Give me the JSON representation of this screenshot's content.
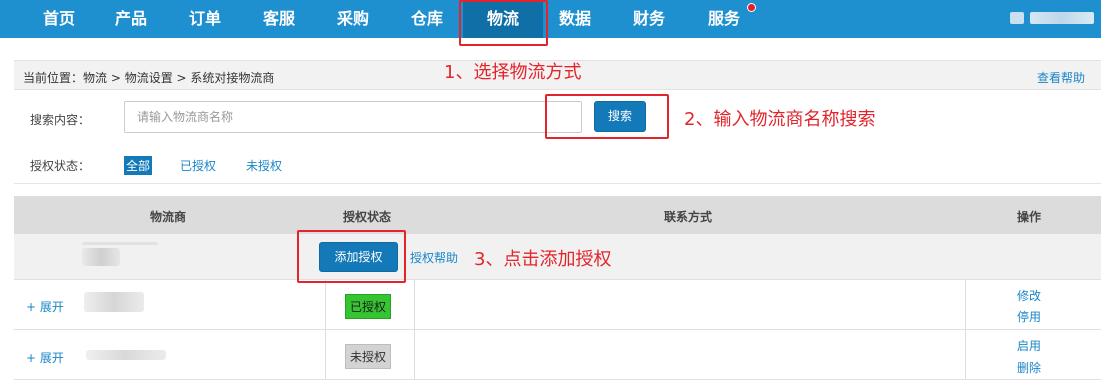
{
  "nav": {
    "items": [
      "首页",
      "产品",
      "订单",
      "客服",
      "采购",
      "仓库",
      "物流",
      "数据",
      "财务",
      "服务"
    ],
    "active": "物流",
    "colors": {
      "bar": "#1e8fcf",
      "active": "#0f6fa6",
      "dot": "#e01e2c"
    }
  },
  "breadcrumb": {
    "label": "当前位置：",
    "path": "物流 > 物流设置 > 系统对接物流商",
    "help": "查看帮助"
  },
  "search": {
    "label": "搜索内容：",
    "placeholder": "请输入物流商名称",
    "button": "搜索"
  },
  "auth_filter": {
    "label": "授权状态：",
    "options": [
      "全部",
      "已授权",
      "未授权"
    ],
    "active": "全部"
  },
  "table": {
    "headers": [
      "物流商",
      "授权状态",
      "联系方式",
      "操作"
    ],
    "add_row": {
      "add_button": "添加授权",
      "help_link": "授权帮助"
    },
    "rows": [
      {
        "expand": "+ 展开",
        "status": "已授权",
        "status_color": "#35c531",
        "actions": [
          "修改",
          "停用"
        ]
      },
      {
        "expand": "+ 展开",
        "status": "未授权",
        "status_color": "#d3d3d3",
        "actions": [
          "启用",
          "删除"
        ]
      }
    ]
  },
  "annotations": {
    "step1": "1、选择物流方式",
    "step2": "2、输入物流商名称搜索",
    "step3": "3、点击添加授权",
    "color": "#e3242b"
  }
}
